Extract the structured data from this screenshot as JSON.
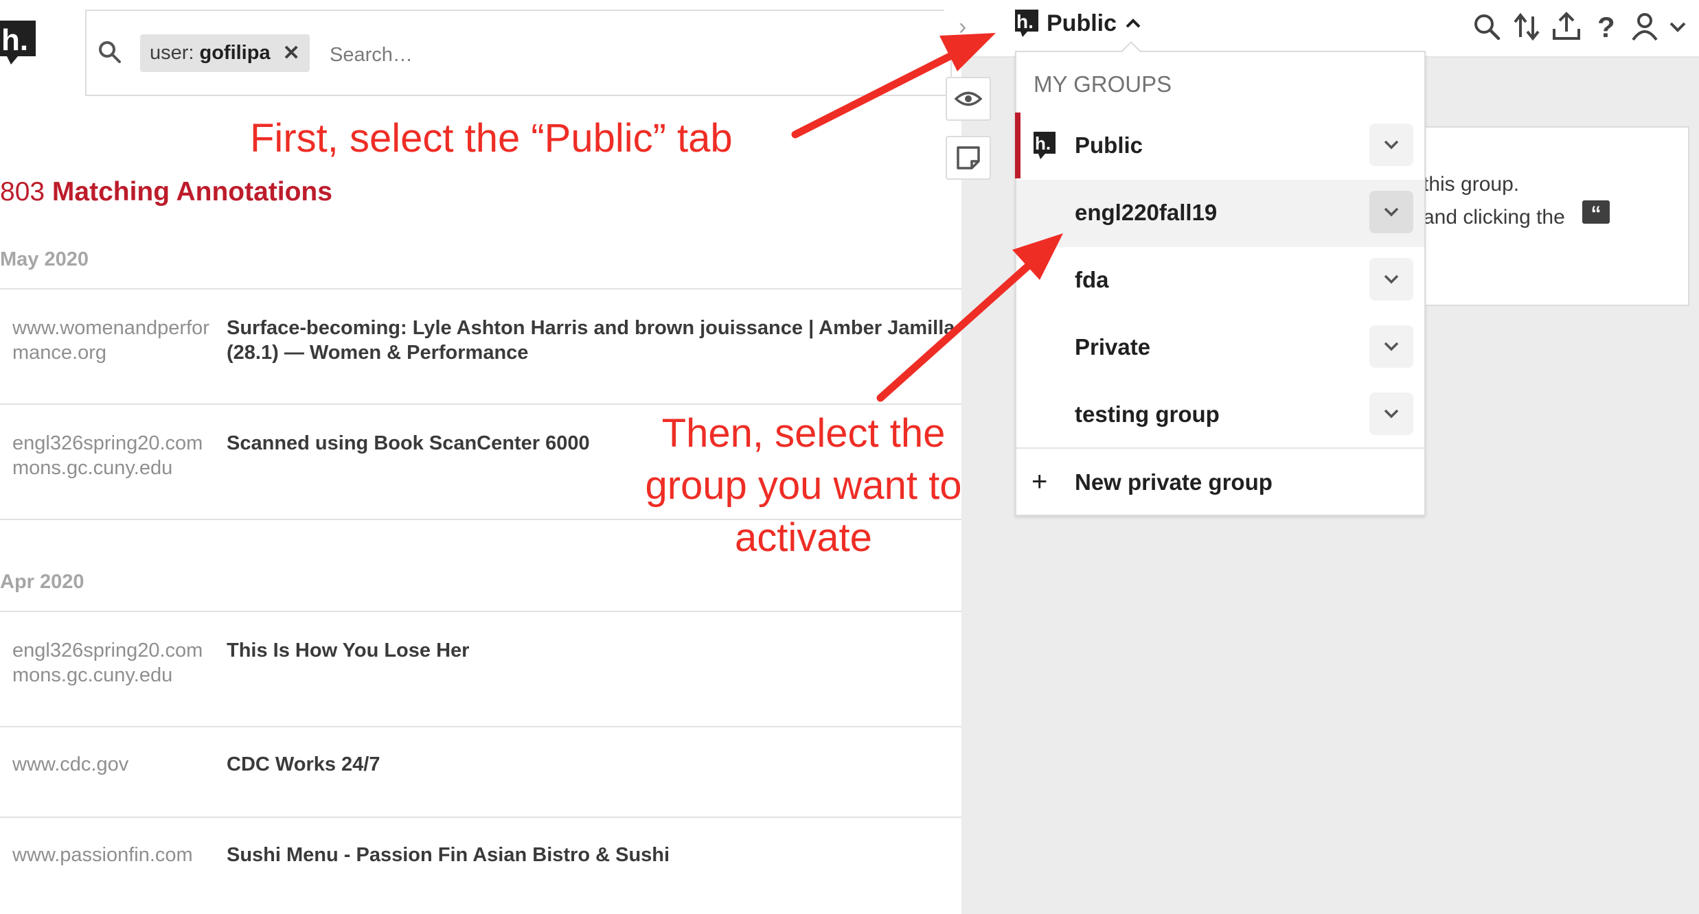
{
  "search": {
    "chip_prefix": "user:",
    "chip_value": "gofilipa",
    "chip_close": "✕",
    "placeholder": "Search…"
  },
  "results": {
    "count": "803",
    "count_label": " Matching Annotations",
    "groups": [
      {
        "date": "May 2020",
        "rows": [
          {
            "domain": "www.womenandperformance.org",
            "title_line1": "Surface-becoming: Lyle Ashton Harris and brown jouissance | Amber Jamilla",
            "title_line2": "(28.1) — Women & Performance"
          },
          {
            "domain": "engl326spring20.commons.gc.cuny.edu",
            "title_line1": "Scanned using Book ScanCenter 6000",
            "title_line2": ""
          }
        ]
      },
      {
        "date": "Apr 2020",
        "rows": [
          {
            "domain": "engl326spring20.commons.gc.cuny.edu",
            "title_line1": "This Is How You Lose Her",
            "title_line2": ""
          },
          {
            "domain": "www.cdc.gov",
            "title_line1": "CDC Works 24/7",
            "title_line2": ""
          },
          {
            "domain": "www.passionfin.com",
            "title_line1": "Sushi Menu - Passion Fin Asian Bistro & Sushi",
            "title_line2": ""
          }
        ]
      }
    ]
  },
  "sidebar": {
    "group_button": "Public",
    "card_line1": "this group.",
    "card_line2": "and clicking the",
    "dropdown": {
      "heading": "MY GROUPS",
      "items": [
        "Public",
        "engl220fall19",
        "fda",
        "Private",
        "testing group"
      ],
      "new_group": "New private group"
    }
  },
  "annotations": {
    "first": "First, select the “Public” tab",
    "then_line1": "Then, select the",
    "then_line2": "group you want to",
    "then_line3": "activate"
  },
  "colors": {
    "brand_red": "#bd1c2b",
    "annotation_red": "#ee2d25",
    "sidebar_bg": "#ececec"
  }
}
